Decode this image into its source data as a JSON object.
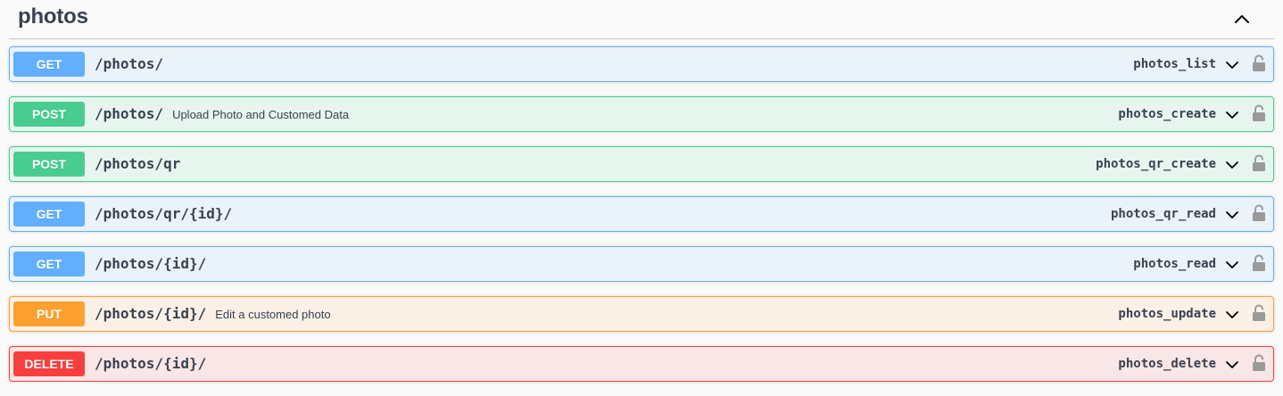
{
  "tag": {
    "title": "photos",
    "collapse_icon": "chevron-up-icon"
  },
  "operations": [
    {
      "method": "GET",
      "path": "/photos/",
      "summary": "",
      "operation_id": "photos_list"
    },
    {
      "method": "POST",
      "path": "/photos/",
      "summary": "Upload Photo and Customed Data",
      "operation_id": "photos_create"
    },
    {
      "method": "POST",
      "path": "/photos/qr",
      "summary": "",
      "operation_id": "photos_qr_create"
    },
    {
      "method": "GET",
      "path": "/photos/qr/{id}/",
      "summary": "",
      "operation_id": "photos_qr_read"
    },
    {
      "method": "GET",
      "path": "/photos/{id}/",
      "summary": "",
      "operation_id": "photos_read"
    },
    {
      "method": "PUT",
      "path": "/photos/{id}/",
      "summary": "Edit a customed photo",
      "operation_id": "photos_update"
    },
    {
      "method": "DELETE",
      "path": "/photos/{id}/",
      "summary": "",
      "operation_id": "photos_delete"
    }
  ],
  "icons": {
    "expand": "chevron-down-icon",
    "lock": "unlocked-padlock-icon"
  },
  "colors": {
    "get": "#61affe",
    "post": "#49cc90",
    "put": "#fca130",
    "delete": "#f93e3e",
    "text": "#3b4151"
  }
}
